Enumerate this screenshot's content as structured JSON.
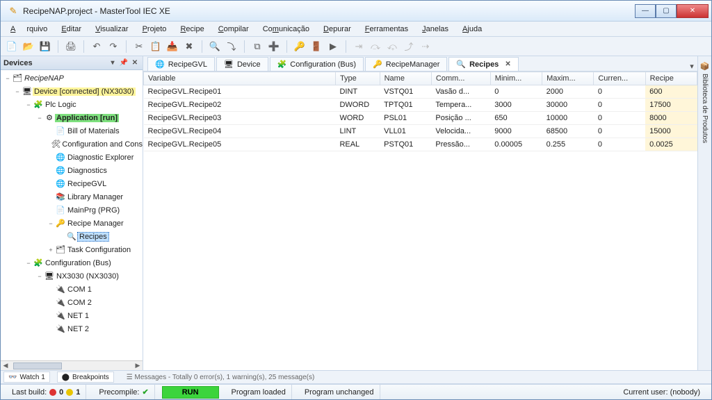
{
  "window": {
    "title": "RecipeNAP.project - MasterTool IEC XE"
  },
  "menu": [
    "Arquivo",
    "Editar",
    "Visualizar",
    "Projeto",
    "Recipe",
    "Compilar",
    "Comunicação",
    "Depurar",
    "Ferramentas",
    "Janelas",
    "Ajuda"
  ],
  "devices_panel": {
    "title": "Devices",
    "root": "RecipeNAP",
    "items": [
      {
        "label": "Device [connected] (NX3030)",
        "hl": "yellow",
        "icon": "🖥",
        "indent": 1,
        "exp": "−"
      },
      {
        "label": "Plc Logic",
        "icon": "🧩",
        "indent": 2,
        "exp": "−"
      },
      {
        "label": "Application [run]",
        "hl": "green",
        "icon": "⚙",
        "indent": 3,
        "exp": "−"
      },
      {
        "label": "Bill of Materials",
        "icon": "📄",
        "indent": 4
      },
      {
        "label": "Configuration and Cons",
        "icon": "🛠",
        "indent": 4
      },
      {
        "label": "Diagnostic Explorer",
        "icon": "🌐",
        "indent": 4
      },
      {
        "label": "Diagnostics",
        "icon": "🌐",
        "indent": 4
      },
      {
        "label": "RecipeGVL",
        "icon": "🌐",
        "indent": 4
      },
      {
        "label": "Library Manager",
        "icon": "📚",
        "indent": 4
      },
      {
        "label": "MainPrg (PRG)",
        "icon": "📄",
        "indent": 4
      },
      {
        "label": "Recipe Manager",
        "icon": "🔑",
        "indent": 4,
        "exp": "−"
      },
      {
        "label": "Recipes",
        "icon": "🔍",
        "indent": 5,
        "selected": true
      },
      {
        "label": "Task Configuration",
        "icon": "🗂",
        "indent": 4,
        "exp": "+"
      },
      {
        "label": "Configuration (Bus)",
        "icon": "🧩",
        "indent": 2,
        "exp": "−"
      },
      {
        "label": "NX3030 (NX3030)",
        "icon": "🖥",
        "indent": 3,
        "exp": "−"
      },
      {
        "label": "COM 1",
        "icon": "🔌",
        "indent": 4
      },
      {
        "label": "COM 2",
        "icon": "🔌",
        "indent": 4
      },
      {
        "label": "NET 1",
        "icon": "🔌",
        "indent": 4
      },
      {
        "label": "NET 2",
        "icon": "🔌",
        "indent": 4
      }
    ]
  },
  "tabs": [
    {
      "label": "RecipeGVL",
      "icon": "🌐"
    },
    {
      "label": "Device",
      "icon": "🖥"
    },
    {
      "label": "Configuration (Bus)",
      "icon": "🧩"
    },
    {
      "label": "RecipeManager",
      "icon": "🔑"
    },
    {
      "label": "Recipes",
      "icon": "🔍",
      "active": true,
      "closable": true
    }
  ],
  "grid": {
    "headers": [
      "Variable",
      "Type",
      "Name",
      "Comm...",
      "Minim...",
      "Maxim...",
      "Curren...",
      "Recipe"
    ],
    "rows": [
      {
        "variable": "RecipeGVL.Recipe01",
        "type": "DINT",
        "name": "VSTQ01",
        "comm": "Vasão d...",
        "min": "0",
        "max": "2000",
        "cur": "0",
        "recipe": "600"
      },
      {
        "variable": "RecipeGVL.Recipe02",
        "type": "DWORD",
        "name": "TPTQ01",
        "comm": "Tempera...",
        "min": "3000",
        "max": "30000",
        "cur": "0",
        "recipe": "17500"
      },
      {
        "variable": "RecipeGVL.Recipe03",
        "type": "WORD",
        "name": "PSL01",
        "comm": "Posição ...",
        "min": "650",
        "max": "10000",
        "cur": "0",
        "recipe": "8000"
      },
      {
        "variable": "RecipeGVL.Recipe04",
        "type": "LINT",
        "name": "VLL01",
        "comm": "Velocida...",
        "min": "9000",
        "max": "68500",
        "cur": "0",
        "recipe": "15000"
      },
      {
        "variable": "RecipeGVL.Recipe05",
        "type": "REAL",
        "name": "PSTQ01",
        "comm": "Pressão...",
        "min": "0.00005",
        "max": "0.255",
        "cur": "0",
        "recipe": "0.0025"
      }
    ]
  },
  "sidetab": {
    "label": "Biblioteca de Produtos"
  },
  "bottom": {
    "watch": "Watch 1",
    "breakpoints": "Breakpoints",
    "messages": "Messages - Totally 0 error(s), 1 warning(s), 25 message(s)"
  },
  "status": {
    "lastbuild_label": "Last build:",
    "err": "0",
    "warn": "1",
    "precompile": "Precompile:",
    "run": "RUN",
    "programloaded": "Program loaded",
    "programunchanged": "Program unchanged",
    "currentuser": "Current user: (nobody)"
  }
}
